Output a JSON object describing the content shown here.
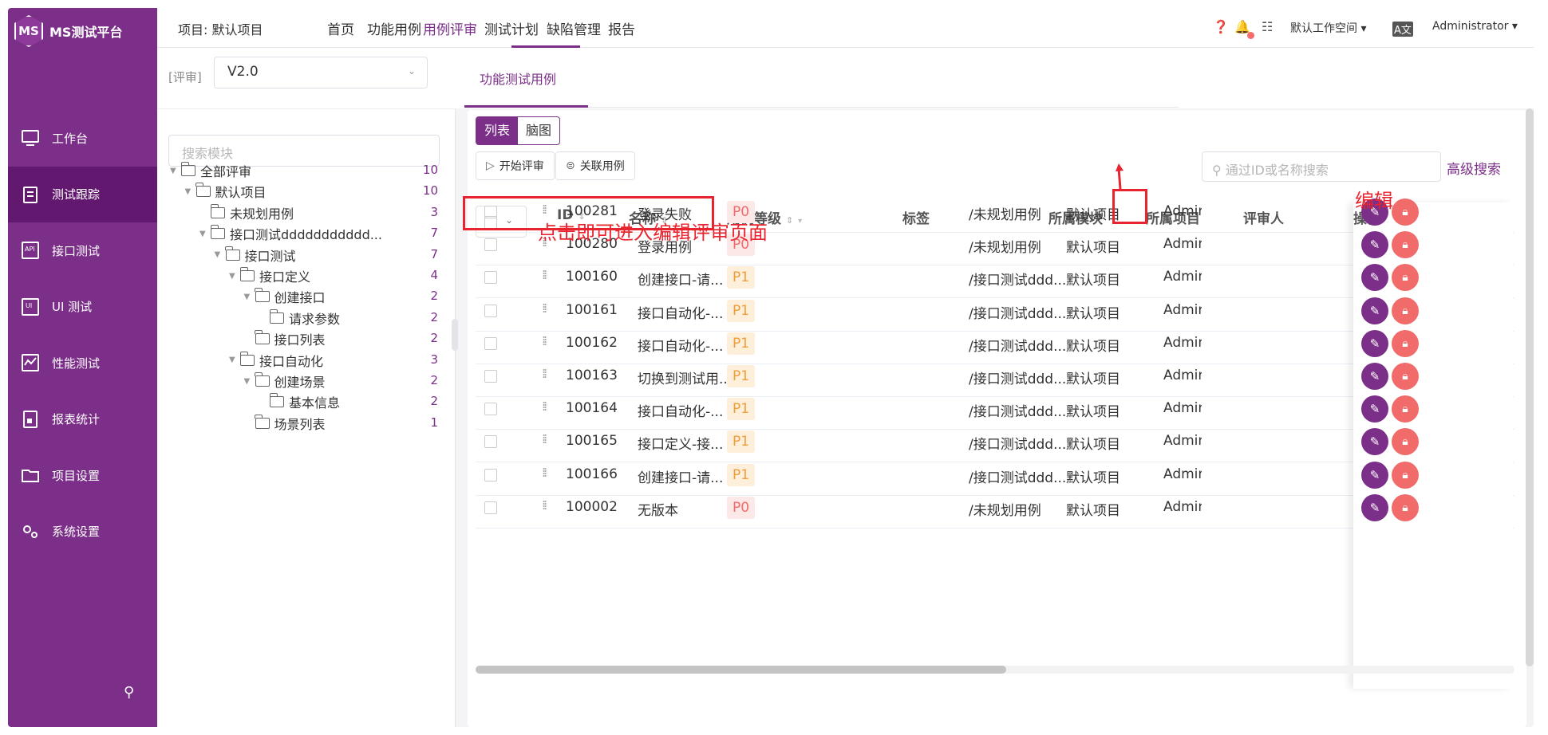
{
  "brand": {
    "logo_text": "MS",
    "title": "MS测试平台"
  },
  "sidebar": {
    "items": [
      {
        "label": "工作台",
        "icon": "monitor-icon"
      },
      {
        "label": "测试跟踪",
        "icon": "clipboard-icon",
        "active": true
      },
      {
        "label": "接口测试",
        "icon": "api-icon"
      },
      {
        "label": "UI 测试",
        "icon": "ui-icon"
      },
      {
        "label": "性能测试",
        "icon": "performance-icon"
      },
      {
        "label": "报表统计",
        "icon": "report-icon"
      },
      {
        "label": "项目设置",
        "icon": "project-folder-icon"
      },
      {
        "label": "系统设置",
        "icon": "gears-icon"
      }
    ]
  },
  "header": {
    "project": "项目: 默认项目",
    "nav": [
      "首页",
      "功能用例",
      "用例评审",
      "测试计划",
      "缺陷管理",
      "报告"
    ],
    "active_nav": "用例评审",
    "workspace": "默认工作空间",
    "user": "Administrator"
  },
  "subheader": {
    "review_label": "[评审]",
    "version": "V2.0",
    "tab": "功能测试用例"
  },
  "tree": {
    "search_placeholder": "搜索模块",
    "nodes": [
      {
        "label": "全部评审",
        "count": "10",
        "level": 0,
        "arrow": true
      },
      {
        "label": "默认项目",
        "count": "10",
        "level": 1,
        "arrow": true
      },
      {
        "label": "未规划用例",
        "count": "3",
        "level": 2,
        "arrow": false
      },
      {
        "label": "接口测试ddddddddddd...",
        "count": "7",
        "level": 2,
        "arrow": true
      },
      {
        "label": "接口测试",
        "count": "7",
        "level": 3,
        "arrow": true
      },
      {
        "label": "接口定义",
        "count": "4",
        "level": 4,
        "arrow": true
      },
      {
        "label": "创建接口",
        "count": "2",
        "level": 5,
        "arrow": true
      },
      {
        "label": "请求参数",
        "count": "2",
        "level": 6,
        "arrow": false
      },
      {
        "label": "接口列表",
        "count": "2",
        "level": 5,
        "arrow": false
      },
      {
        "label": "接口自动化",
        "count": "3",
        "level": 4,
        "arrow": true
      },
      {
        "label": "创建场景",
        "count": "2",
        "level": 5,
        "arrow": true
      },
      {
        "label": "基本信息",
        "count": "2",
        "level": 6,
        "arrow": false
      },
      {
        "label": "场景列表",
        "count": "1",
        "level": 5,
        "arrow": false
      }
    ]
  },
  "toolbar": {
    "view_list": "列表",
    "view_mind": "脑图",
    "start_review": "开始评审",
    "relate_case": "关联用例",
    "search_placeholder": "通过ID或名称搜索",
    "advanced_search": "高级搜索"
  },
  "table": {
    "columns": {
      "id": "ID",
      "name": "名称",
      "priority": "用例等级",
      "tags": "标签",
      "module": "所属模块",
      "project": "所属项目",
      "reviewer": "评审人",
      "ops": "操作"
    },
    "rows": [
      {
        "id": "100281",
        "name": "登录失败",
        "priority": "P0",
        "module": "/未规划用例",
        "project": "默认项目",
        "reviewer": "Admin"
      },
      {
        "id": "100280",
        "name": "登录用例",
        "priority": "P0",
        "module": "/未规划用例",
        "project": "默认项目",
        "reviewer": "Admin"
      },
      {
        "id": "100160",
        "name": "创建接口-请...",
        "priority": "P1",
        "module": "/接口测试ddd...",
        "project": "默认项目",
        "reviewer": "Admin"
      },
      {
        "id": "100161",
        "name": "接口自动化-...",
        "priority": "P1",
        "module": "/接口测试ddd...",
        "project": "默认项目",
        "reviewer": "Admin"
      },
      {
        "id": "100162",
        "name": "接口自动化-...",
        "priority": "P1",
        "module": "/接口测试ddd...",
        "project": "默认项目",
        "reviewer": "Admin"
      },
      {
        "id": "100163",
        "name": "切换到测试用...",
        "priority": "P1",
        "module": "/接口测试ddd...",
        "project": "默认项目",
        "reviewer": "Admin"
      },
      {
        "id": "100164",
        "name": "接口自动化-...",
        "priority": "P1",
        "module": "/接口测试ddd...",
        "project": "默认项目",
        "reviewer": "Admin"
      },
      {
        "id": "100165",
        "name": "接口定义-接...",
        "priority": "P1",
        "module": "/接口测试ddd...",
        "project": "默认项目",
        "reviewer": "Admin"
      },
      {
        "id": "100166",
        "name": "创建接口-请...",
        "priority": "P1",
        "module": "/接口测试ddd...",
        "project": "默认项目",
        "reviewer": "Admin"
      },
      {
        "id": "100002",
        "name": "无版本",
        "priority": "P0",
        "module": "/未规划用例",
        "project": "默认项目",
        "reviewer": "Admin"
      }
    ]
  },
  "annotations": {
    "hint": "点击即可进入编辑评审页面",
    "edit": "编辑"
  },
  "colors": {
    "primary": "#7b2f88",
    "sidebar_active": "#63186f",
    "danger": "#f16b6b",
    "annotation": "#e8242f"
  }
}
